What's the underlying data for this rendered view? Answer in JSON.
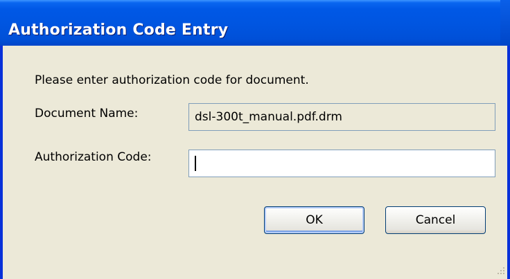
{
  "window": {
    "title": "Authorization Code Entry"
  },
  "dialog": {
    "prompt": "Please enter authorization code for document.",
    "document_name_label": "Document Name:",
    "document_name_value": "dsl-300t_manual.pdf.drm",
    "authorization_code_label": "Authorization Code:",
    "authorization_code_value": ""
  },
  "buttons": {
    "ok_label": "OK",
    "cancel_label": "Cancel"
  },
  "colors": {
    "titlebar": "#0055e0",
    "dialog_background": "#ece9d8",
    "field_border": "#7f9db9",
    "button_border": "#003c74"
  },
  "icons": {
    "resize_grip": "resize-grip-icon"
  }
}
